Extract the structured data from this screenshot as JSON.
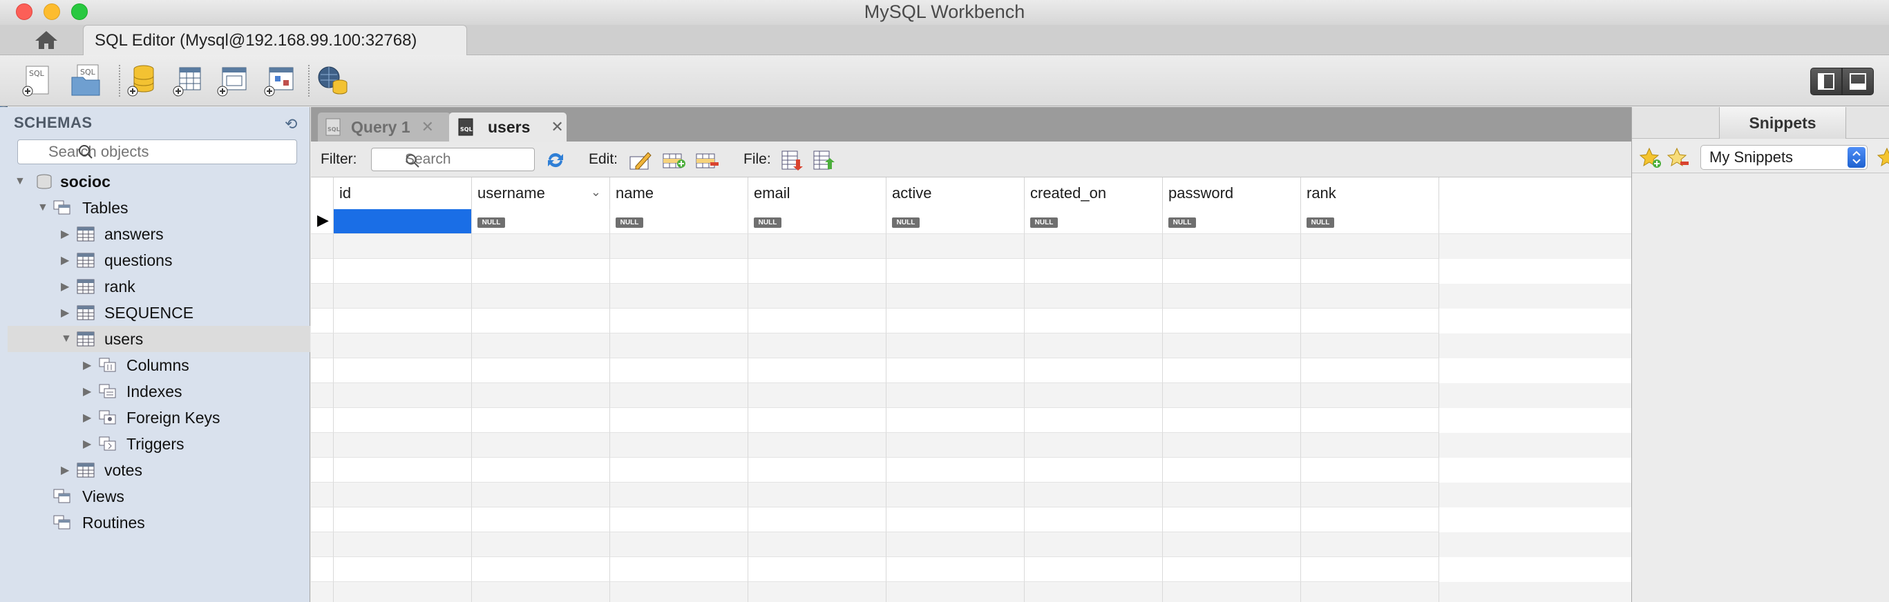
{
  "window": {
    "title": "MySQL Workbench"
  },
  "tabs": {
    "connection_tab_label": "SQL Editor (Mysql@192.168.99.100:32768)"
  },
  "sidebar": {
    "title": "SCHEMAS",
    "search_placeholder": "Search objects",
    "schema": "socioc",
    "tables_label": "Tables",
    "tables": [
      "answers",
      "questions",
      "rank",
      "SEQUENCE",
      "users",
      "votes"
    ],
    "users_children": [
      "Columns",
      "Indexes",
      "Foreign Keys",
      "Triggers"
    ],
    "views_label": "Views",
    "routines_label": "Routines"
  },
  "query_tabs": [
    {
      "label": "Query 1",
      "active": false
    },
    {
      "label": "users",
      "active": true
    }
  ],
  "filterbar": {
    "filter_label": "Filter:",
    "search_placeholder": "Search",
    "edit_label": "Edit:",
    "file_label": "File:"
  },
  "grid": {
    "columns": [
      "id",
      "username",
      "name",
      "email",
      "active",
      "created_on",
      "password",
      "rank"
    ],
    "null_text": "NULL"
  },
  "snippets": {
    "title": "Snippets",
    "selected": "My Snippets"
  },
  "colors": {
    "selection": "#1a6ee6",
    "sidebar_bg": "#d9e1ed"
  }
}
